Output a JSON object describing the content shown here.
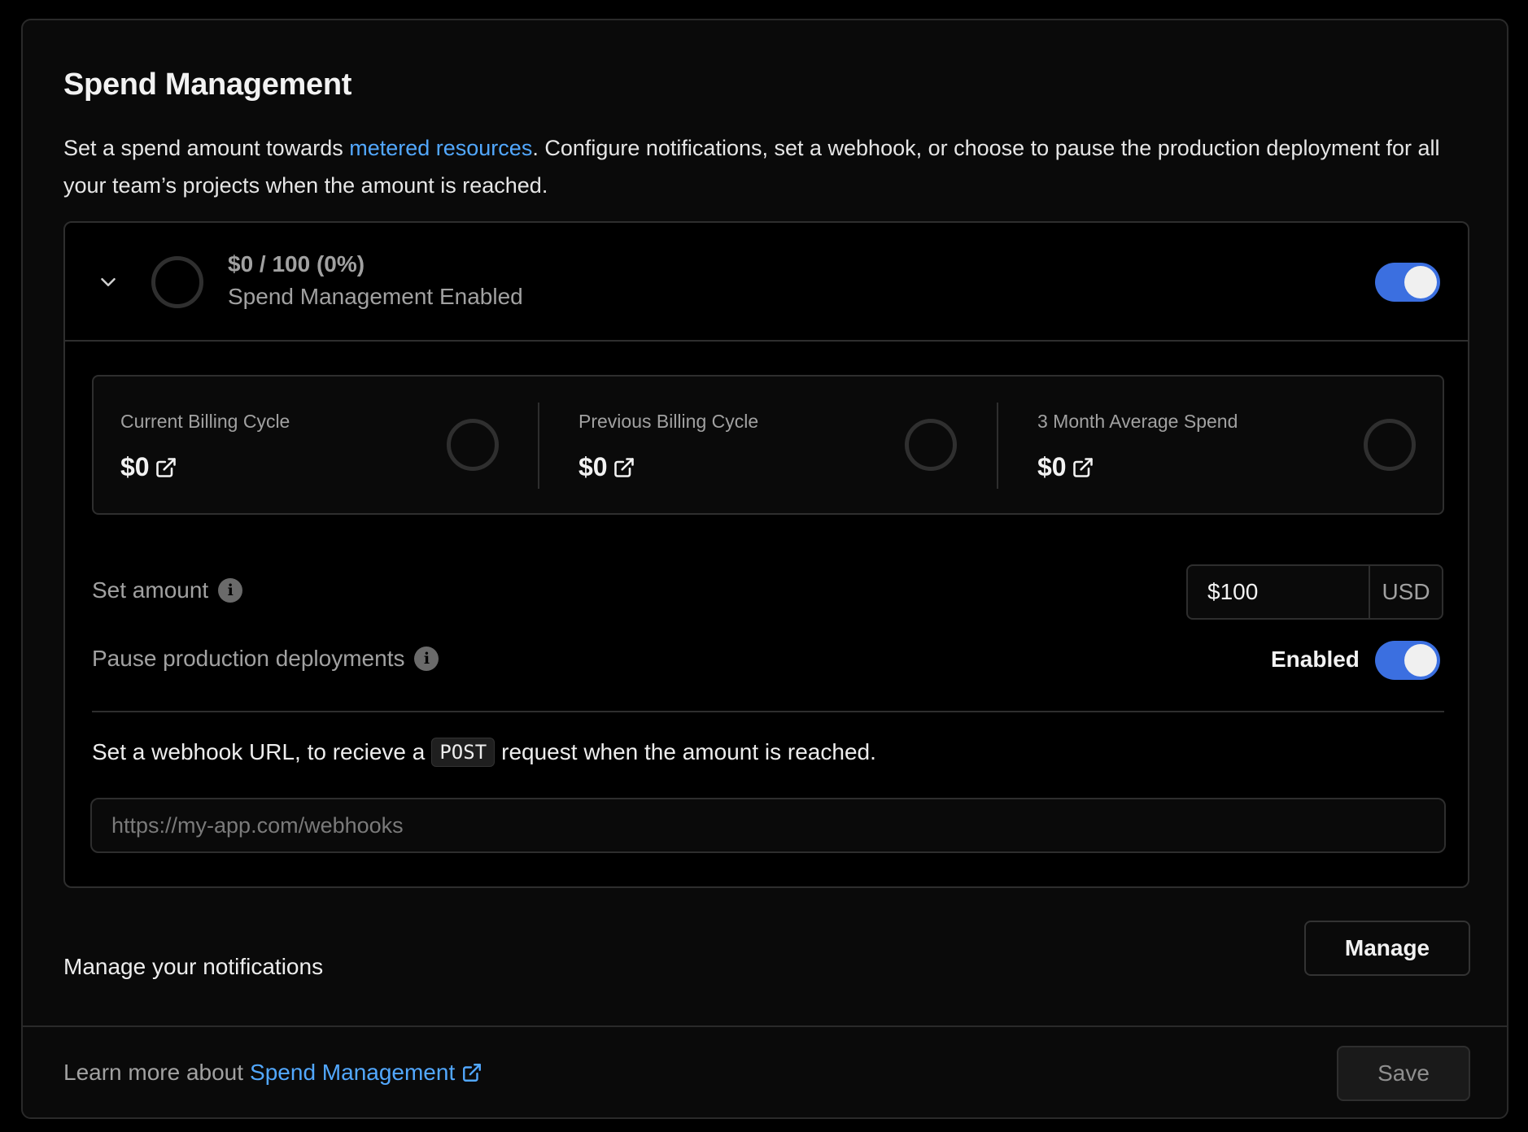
{
  "section": {
    "title": "Spend Management",
    "desc_before": "Set a spend amount towards ",
    "desc_link": "metered resources",
    "desc_after": ". Configure notifications, set a webhook, or choose to pause the production deployment for all your team’s projects when the amount is reached."
  },
  "panel": {
    "amount_summary": "$0 / 100 (0%)",
    "status": "Spend Management Enabled",
    "enabled": true
  },
  "stats": [
    {
      "label": "Current Billing Cycle",
      "value": "$0"
    },
    {
      "label": "Previous Billing Cycle",
      "value": "$0"
    },
    {
      "label": "3 Month Average Spend",
      "value": "$0"
    }
  ],
  "set_amount": {
    "label": "Set amount",
    "value": "$100",
    "currency": "USD"
  },
  "pause": {
    "label": "Pause production deployments",
    "state_label": "Enabled",
    "enabled": true
  },
  "webhook": {
    "text_before": "Set a webhook URL, to recieve a",
    "method": "POST",
    "text_after": "request when the amount is reached.",
    "placeholder": "https://my-app.com/webhooks"
  },
  "notifications": {
    "label": "Manage your notifications",
    "button": "Manage"
  },
  "footer": {
    "text": "Learn more about",
    "link": "Spend Management",
    "save_button": "Save"
  },
  "colors": {
    "accent": "#3b6fe0",
    "link": "#52a8ff",
    "background": "#0a0a0a"
  }
}
